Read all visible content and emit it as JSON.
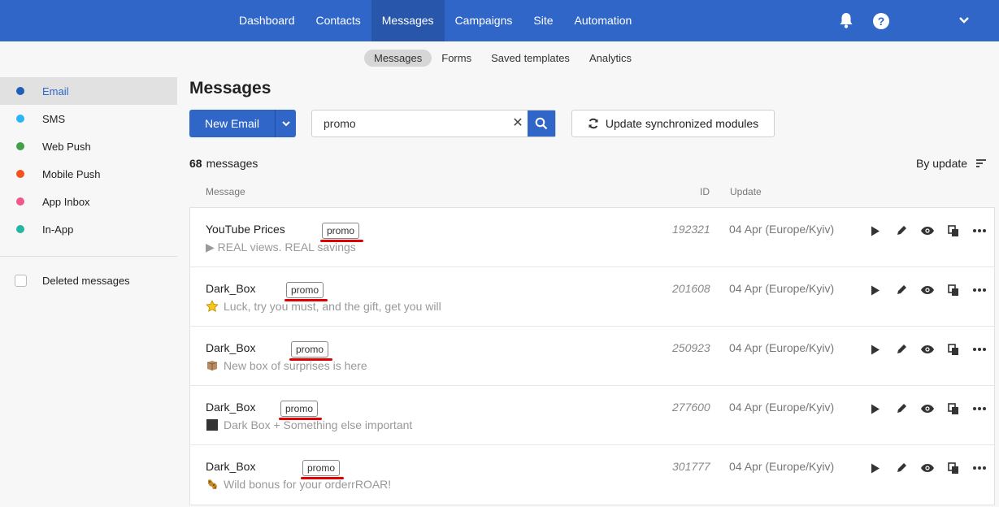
{
  "topnav": {
    "items": [
      "Dashboard",
      "Contacts",
      "Messages",
      "Campaigns",
      "Site",
      "Automation"
    ],
    "active_index": 2,
    "help_label": "?"
  },
  "subnav": {
    "items": [
      "Messages",
      "Forms",
      "Saved templates",
      "Analytics"
    ],
    "active_index": 0
  },
  "sidebar": {
    "items": [
      {
        "label": "Email",
        "color": "#1f5fb8"
      },
      {
        "label": "SMS",
        "color": "#29b6f6"
      },
      {
        "label": "Web Push",
        "color": "#43a047"
      },
      {
        "label": "Mobile Push",
        "color": "#f4511e"
      },
      {
        "label": "App Inbox",
        "color": "#f0588a"
      },
      {
        "label": "In-App",
        "color": "#26b5a0"
      }
    ],
    "active_index": 0,
    "deleted_label": "Deleted messages"
  },
  "main": {
    "title": "Messages",
    "new_email_label": "New Email",
    "search_value": "promo",
    "sync_label": "Update synchronized modules",
    "count_number": "68",
    "count_label": "messages",
    "sort_label": "By update",
    "columns": {
      "message": "Message",
      "id": "ID",
      "update": "Update"
    }
  },
  "colors": {
    "accent": "#2f66c8",
    "highlight_underline": "#e00000"
  },
  "messages": [
    {
      "name": "YouTube Prices",
      "tag": "promo",
      "emoji": "play-triangle-icon",
      "subject": "▶ REAL views. REAL savings",
      "id": "192321",
      "date": "04 Apr (Europe/Kyiv)"
    },
    {
      "name": "Dark_Box",
      "tag": "promo",
      "emoji": "star-icon",
      "subject": "Luck, try you must, and the gift, get you will",
      "id": "201608",
      "date": "04 Apr (Europe/Kyiv)"
    },
    {
      "name": "Dark_Box",
      "tag": "promo",
      "emoji": "box-icon",
      "subject": "New box of surprises is here",
      "id": "250923",
      "date": "04 Apr (Europe/Kyiv)"
    },
    {
      "name": "Dark_Box",
      "tag": "promo",
      "emoji": "black-square-icon",
      "subject": "Dark Box + Something else important",
      "id": "277600",
      "date": "04 Apr (Europe/Kyiv)"
    },
    {
      "name": "Dark_Box",
      "tag": "promo",
      "emoji": "leopard-icon",
      "subject": "Wild bonus for your orderrROAR!",
      "id": "301777",
      "date": "04 Apr (Europe/Kyiv)"
    }
  ]
}
